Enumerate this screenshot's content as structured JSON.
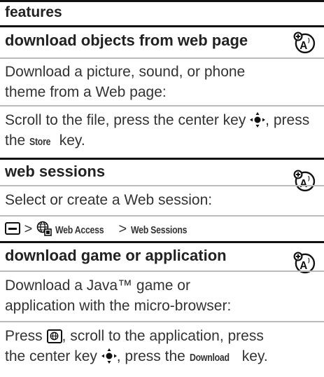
{
  "header": {
    "title": "features"
  },
  "features": [
    {
      "title": "download objects from web page",
      "description": "Download a picture, sound, or phone theme from a Web page:",
      "instruction_part1": "Scroll to the file, press the center key",
      "instruction_part2": ", press the",
      "key_name": "Store",
      "instruction_part3": "key."
    },
    {
      "title": "web sessions",
      "description": "Select or create a Web session:",
      "path_sep1": ">",
      "path_menu": "Web Access",
      "path_sep2": ">",
      "path_item": "Web Sessions"
    },
    {
      "title": "download game or application",
      "description_line1": "Download a Java™ game or",
      "description_line2": "application with the micro-browser:",
      "instruction_part1": "Press",
      "instruction_part2": ", scroll to the application, press",
      "instruction_part3": "the center key",
      "instruction_part4": ", press the",
      "key_name": "Download",
      "instruction_part5": "key."
    }
  ],
  "icons": {
    "feature_badge": "network-feature-badge-icon",
    "center_key": "center-nav-key-icon",
    "menu_key": "menu-key-icon",
    "web_access": "web-access-globe-icon",
    "browser_key": "browser-key-icon"
  }
}
